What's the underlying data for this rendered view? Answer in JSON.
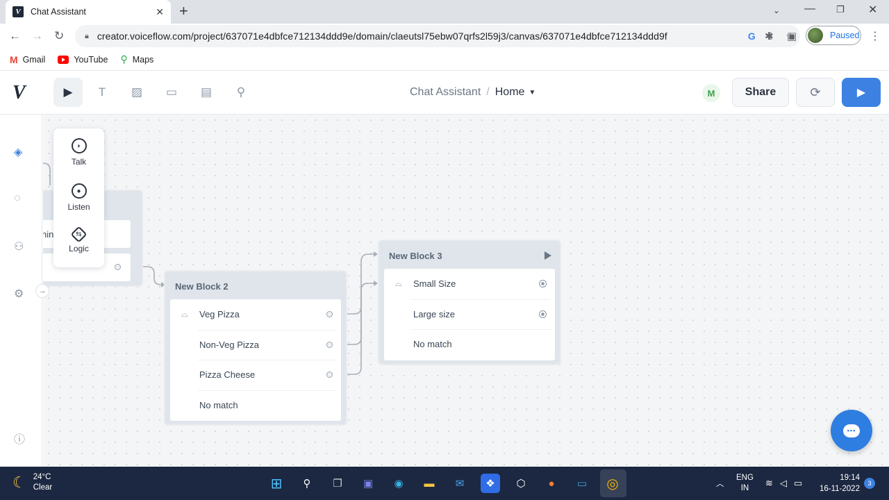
{
  "browser": {
    "tab_title": "Chat Assistant",
    "tab_favicon": "V",
    "url": "creator.voiceflow.com/project/637071e4dbfce712134ddd9e/domain/claeutsl75ebw07qrfs2l59j3/canvas/637071e4dbfce712134ddd9f",
    "profile_status": "Paused",
    "bookmarks": [
      {
        "label": "Gmail",
        "icon": "gmail-icon"
      },
      {
        "label": "YouTube",
        "icon": "youtube-icon"
      },
      {
        "label": "Maps",
        "icon": "maps-icon"
      }
    ]
  },
  "header": {
    "project": "Chat Assistant",
    "separator": "/",
    "domain": "Home",
    "user_initial": "M",
    "share_label": "Share",
    "tools": [
      "pointer-icon",
      "text-icon",
      "image-icon",
      "comment-icon",
      "component-icon",
      "search-icon"
    ]
  },
  "step_menu": [
    {
      "label": "Talk",
      "icon": "talk-icon"
    },
    {
      "label": "Listen",
      "icon": "listen-icon"
    },
    {
      "label": "Logic",
      "icon": "logic-icon"
    }
  ],
  "partial_block": {
    "visible_text": "nin"
  },
  "block2": {
    "title": "New Block 2",
    "steps": [
      "Veg Pizza",
      "Non-Veg Pizza",
      "Pizza Cheese",
      "No match"
    ]
  },
  "block3": {
    "title": "New Block 3",
    "steps": [
      "Small Size",
      "Large size",
      "No match"
    ]
  },
  "taskbar": {
    "temperature": "24°C",
    "weather": "Clear",
    "lang_line1": "ENG",
    "lang_line2": "IN",
    "time": "19:14",
    "date": "16-11-2022",
    "notifications": "3"
  },
  "colors": {
    "accent": "#3d82e2",
    "canvas_bg": "#f4f5f6",
    "block_bg": "#dfe5eb",
    "taskbar_bg": "#1c2841"
  }
}
